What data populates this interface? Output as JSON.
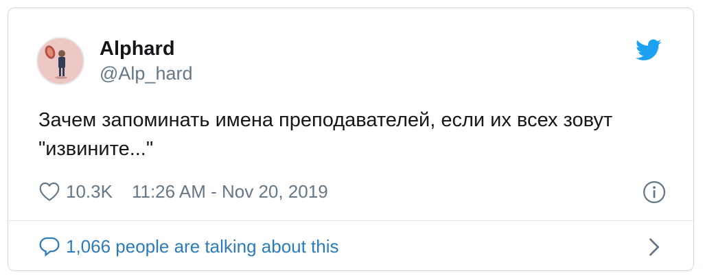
{
  "tweet": {
    "author": {
      "display_name": "Alphard",
      "handle": "@Alp_hard"
    },
    "text": "Зачем запоминать имена преподавателей, если их всех зовут \"извините...\"",
    "likes": "10.3K",
    "timestamp": "11:26 AM - Nov 20, 2019",
    "talking_about": "1,066 people are talking about this"
  },
  "icons": {
    "brand": "twitter-bird-icon",
    "like": "heart-icon",
    "info": "info-icon",
    "conversation": "speech-bubble-icon",
    "more": "chevron-right-icon"
  },
  "colors": {
    "brand": "#1da1f2",
    "text": "#14171a",
    "secondary": "#657786",
    "link": "#2b7bb9",
    "border": "#cfd9de"
  }
}
